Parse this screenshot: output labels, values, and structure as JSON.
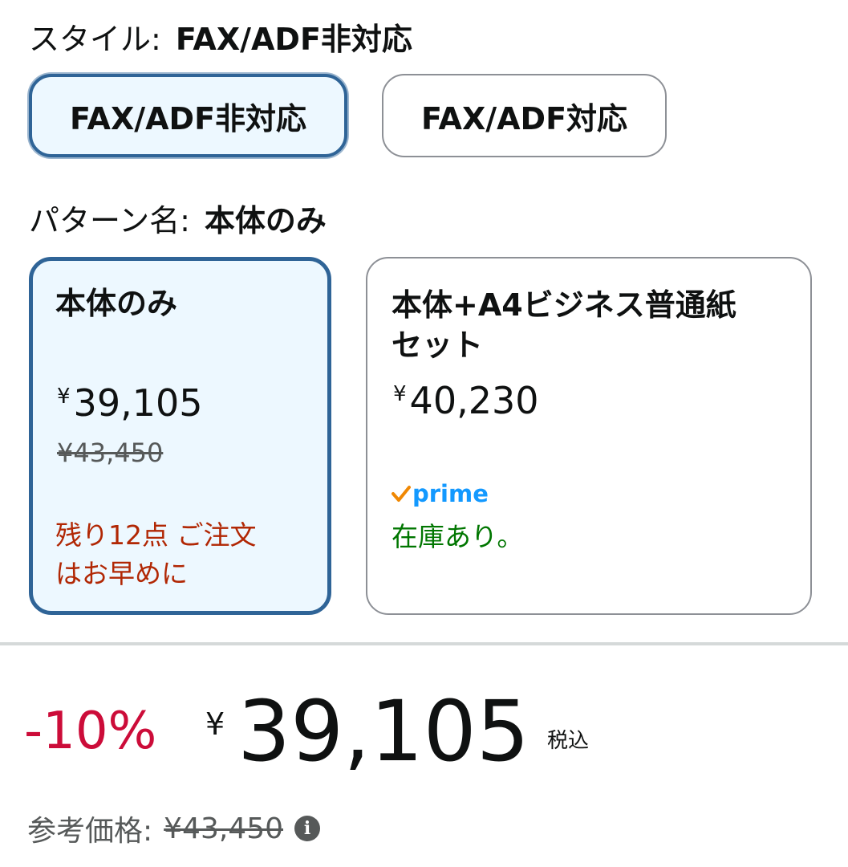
{
  "style_section": {
    "label": "スタイル:",
    "selected_value": "FAX/ADF非対応",
    "options": [
      {
        "label": "FAX/ADF非対応",
        "selected": true
      },
      {
        "label": "FAX/ADF対応",
        "selected": false
      }
    ]
  },
  "pattern_section": {
    "label": "パターン名:",
    "selected_value": "本体のみ",
    "options": [
      {
        "name": "本体のみ",
        "currency": "¥",
        "price": "39,105",
        "list_price": "¥43,450",
        "stock_line1": "残り12点 ご注文",
        "stock_line2": "はお早めに",
        "selected": true
      },
      {
        "name_line1": "本体+A4ビジネス普通紙",
        "name_line2": "セット",
        "currency": "¥",
        "price": "40,230",
        "prime_label": "prime",
        "stock": "在庫あり。",
        "selected": false
      }
    ]
  },
  "price_block": {
    "discount": "-10%",
    "currency": "¥",
    "price": "39,105",
    "tax_note": "税込",
    "reference_label": "参考価格:",
    "reference_price": "¥43,450",
    "info_icon": "info-icon"
  },
  "colors": {
    "selected_border": "#2f6497",
    "selected_bg": "#edf8ff",
    "discount_red": "#cc0c39",
    "low_stock_red": "#b12704",
    "in_stock_green": "#007600",
    "prime_blue": "#1399ff",
    "prime_check_orange": "#f08804"
  }
}
